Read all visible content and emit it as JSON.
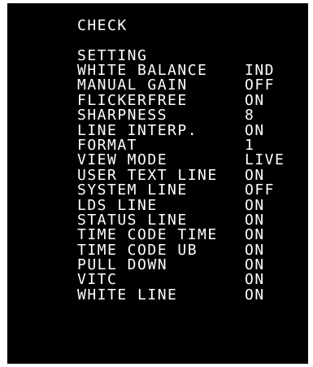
{
  "menu": {
    "title": "CHECK",
    "section": "SETTING",
    "items": [
      {
        "label": "WHITE BALANCE",
        "value": "IND"
      },
      {
        "label": "MANUAL GAIN",
        "value": "OFF"
      },
      {
        "label": "FLICKERFREE",
        "value": "ON"
      },
      {
        "label": "SHARPNESS",
        "value": "8"
      },
      {
        "label": "LINE INTERP.",
        "value": "ON"
      },
      {
        "label": "FORMAT",
        "value": "1"
      },
      {
        "label": "VIEW MODE",
        "value": "LIVE"
      },
      {
        "label": "USER TEXT LINE",
        "value": "ON"
      },
      {
        "label": "SYSTEM LINE",
        "value": "OFF"
      },
      {
        "label": "LDS LINE",
        "value": "ON"
      },
      {
        "label": "STATUS LINE",
        "value": "ON"
      },
      {
        "label": "TIME CODE TIME",
        "value": "ON"
      },
      {
        "label": "TIME CODE UB",
        "value": "ON"
      },
      {
        "label": "PULL DOWN",
        "value": "ON"
      },
      {
        "label": "VITC",
        "value": "ON"
      },
      {
        "label": "WHITE LINE",
        "value": "ON"
      }
    ]
  },
  "colors": {
    "background": "#000000",
    "text": "#ffffff",
    "border": "#ffffff"
  }
}
